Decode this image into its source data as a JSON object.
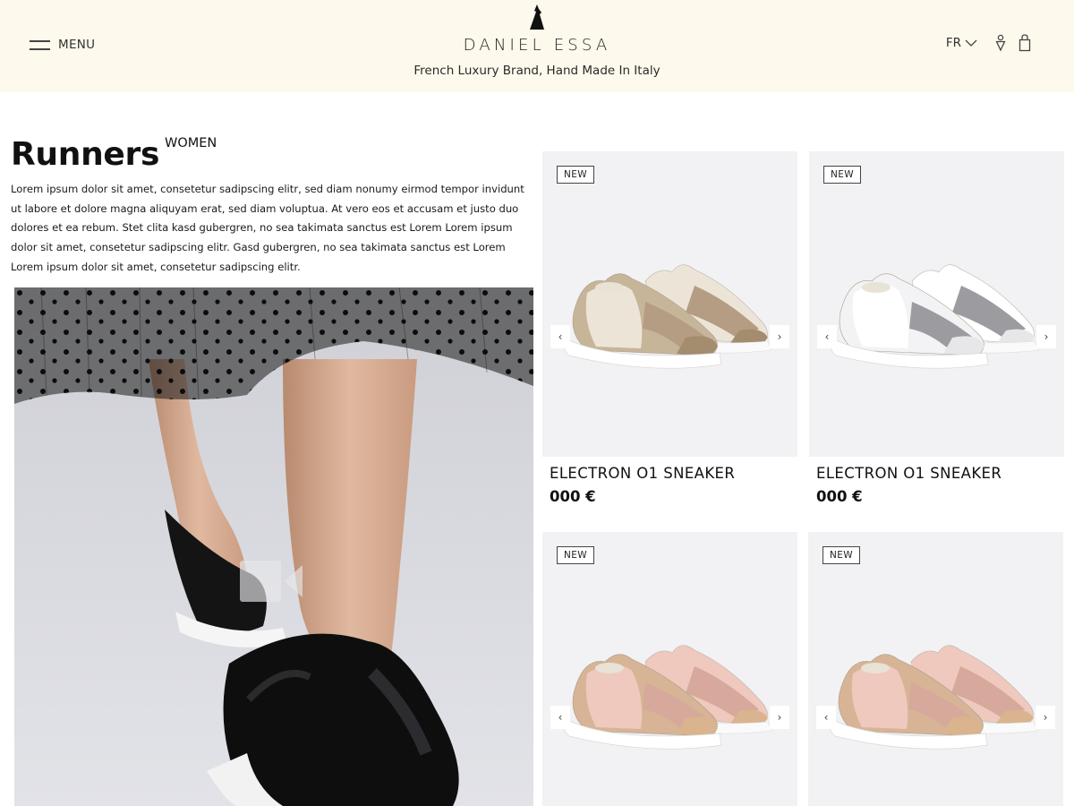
{
  "header": {
    "menu_label": "MENU",
    "brand": "DANIEL ESSA",
    "tagline": "French Luxury Brand, Hand Made In Italy",
    "language": "FR"
  },
  "intro": {
    "title": "Runners",
    "subtitle": "WOMEN",
    "description": "Lorem ipsum dolor sit amet, consetetur sadipscing elitr, sed diam nonumy eirmod tempor invidunt ut labore et dolore magna aliquyam erat, sed diam voluptua. At vero eos et accusam et justo duo dolores et ea rebum. Stet clita kasd gubergren, no sea takimata sanctus est Lorem Lorem ipsum dolor sit amet, consetetur sadipscing elitr.  Gasd gubergren, no sea takimata sanctus est Lorem Lorem ipsum dolor sit amet, consetetur sadipscing elitr."
  },
  "products": [
    {
      "badge": "NEW",
      "name": "ELECTRON O1 SNEAKER",
      "price": "000 €",
      "colors": {
        "base": "#c7b59a",
        "toe": "#a38d6e",
        "band": "#b49d82",
        "panel": "#ece5d7"
      }
    },
    {
      "badge": "NEW",
      "name": "ELECTRON O1 SNEAKER",
      "price": "000 €",
      "colors": {
        "base": "#f3f3f5",
        "toe": "#e7e7ea",
        "band": "#9c9ba0",
        "panel": "#ffffff"
      }
    },
    {
      "badge": "NEW",
      "name": "",
      "price": "",
      "colors": {
        "base": "#d7b496",
        "toe": "#d9b48e",
        "band": "#d6a99c",
        "panel": "#efc9be"
      }
    },
    {
      "badge": "NEW",
      "name": "",
      "price": "",
      "colors": {
        "base": "#d7b496",
        "toe": "#d9b48e",
        "band": "#d6a99c",
        "panel": "#efc9be"
      }
    }
  ],
  "icons": {
    "prev": "chevron-left-icon",
    "next": "chevron-right-icon",
    "video": "video-camera-icon",
    "location": "location-pin-icon",
    "bag": "shopping-bag-icon"
  }
}
